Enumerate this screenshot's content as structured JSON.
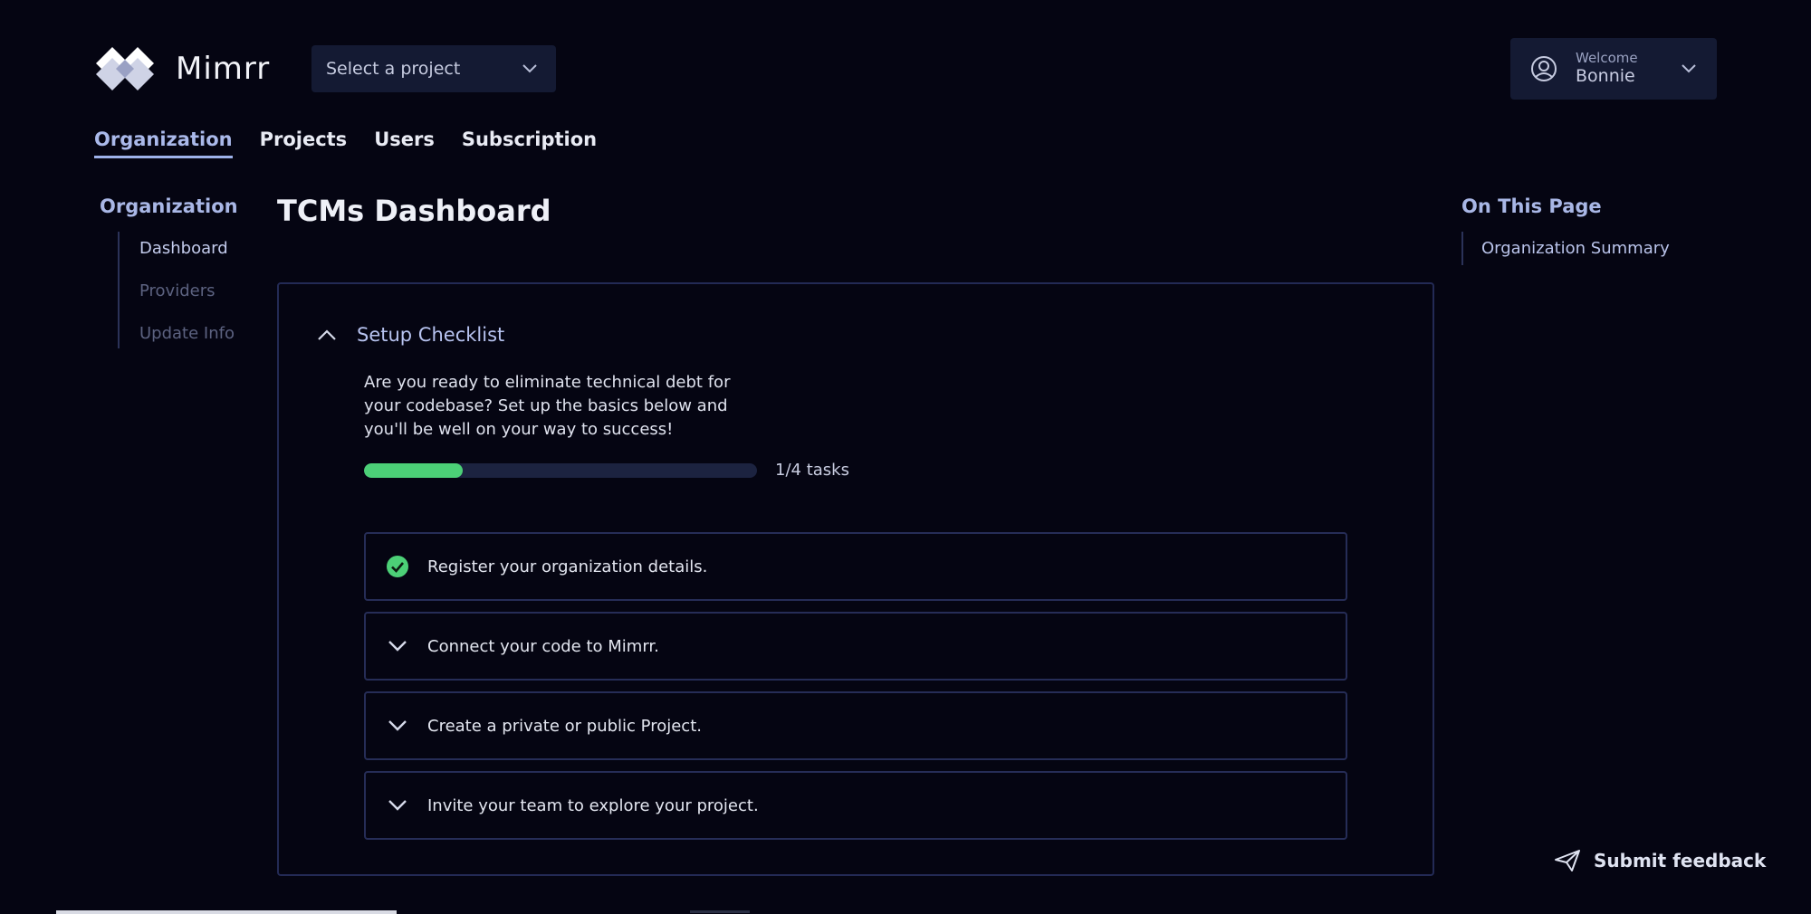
{
  "app": {
    "name": "Mimrr"
  },
  "header": {
    "project_select": {
      "placeholder": "Select a project"
    },
    "user": {
      "welcome": "Welcome",
      "name": "Bonnie"
    }
  },
  "topnav": {
    "items": [
      {
        "label": "Organization",
        "active": true
      },
      {
        "label": "Projects"
      },
      {
        "label": "Users"
      },
      {
        "label": "Subscription"
      }
    ]
  },
  "sidenav": {
    "title": "Organization",
    "items": [
      {
        "label": "Dashboard",
        "current": true
      },
      {
        "label": "Providers"
      },
      {
        "label": "Update Info"
      }
    ]
  },
  "page": {
    "title": "TCMs Dashboard"
  },
  "checklist": {
    "title": "Setup Checklist",
    "description": "Are you ready to eliminate technical debt for your codebase? Set up the basics below and you'll be well on your way to success!",
    "progress": {
      "completed": 1,
      "total": 4,
      "label": "1/4 tasks"
    },
    "tasks": [
      {
        "label": "Register your organization details.",
        "done": true
      },
      {
        "label": "Connect your code to Mimrr.",
        "done": false
      },
      {
        "label": "Create a private or public Project.",
        "done": false
      },
      {
        "label": "Invite your team to explore your project.",
        "done": false
      }
    ]
  },
  "toc": {
    "title": "On This Page",
    "items": [
      {
        "label": "Organization Summary"
      }
    ]
  },
  "feedback": {
    "label": "Submit feedback"
  },
  "colors": {
    "accent": "#a9b7e6",
    "success": "#4cd077",
    "panel": "#141a33",
    "border": "#232a55"
  }
}
